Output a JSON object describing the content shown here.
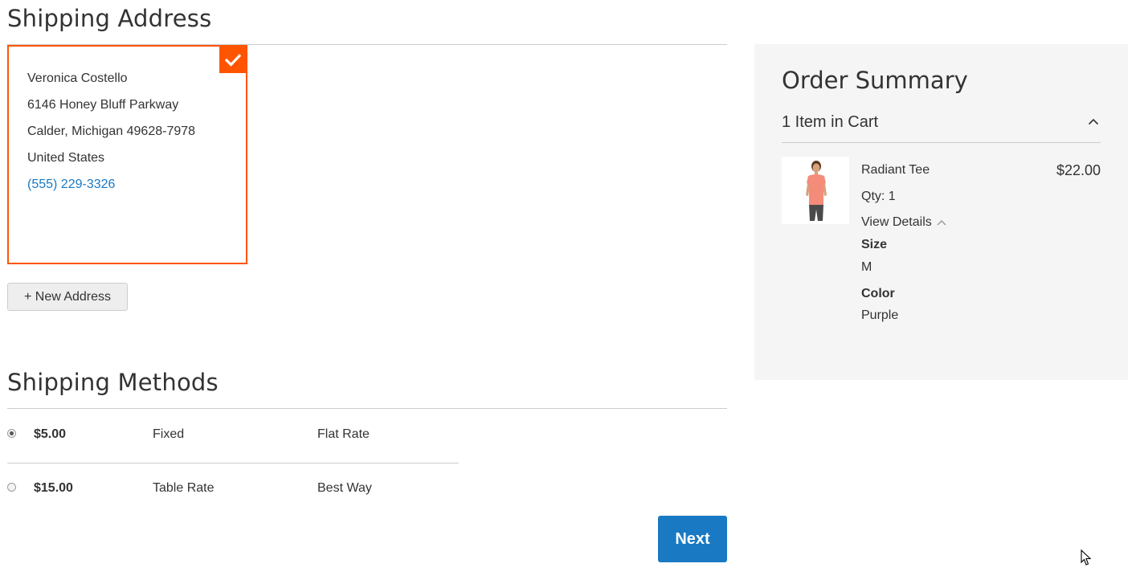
{
  "shipping_address": {
    "title": "Shipping Address",
    "selected_address": {
      "name": "Veronica Costello",
      "street": "6146 Honey Bluff Parkway",
      "city_line": "Calder, Michigan 49628-7978",
      "country": "United States",
      "phone": "(555) 229-3326"
    },
    "new_address_label": "+ New Address"
  },
  "shipping_methods": {
    "title": "Shipping Methods",
    "rows": [
      {
        "price": "$5.00",
        "method": "Fixed",
        "carrier": "Flat Rate",
        "selected": true
      },
      {
        "price": "$15.00",
        "method": "Table Rate",
        "carrier": "Best Way",
        "selected": false
      }
    ],
    "next_label": "Next"
  },
  "order_summary": {
    "title": "Order Summary",
    "cart_count": "1 Item in Cart",
    "item": {
      "name": "Radiant Tee",
      "price": "$22.00",
      "qty": "Qty: 1",
      "view_details": "View Details",
      "size_label": "Size",
      "size_value": "M",
      "color_label": "Color",
      "color_value": "Purple"
    }
  },
  "colors": {
    "accent": "#ff5501",
    "link": "#1979c3",
    "primary_button": "#1979c3",
    "summary_bg": "#f5f5f5"
  },
  "icons": {
    "selected_check": "checkmark-icon",
    "collapse": "chevron-up-icon",
    "cursor": "mouse-pointer-icon"
  }
}
